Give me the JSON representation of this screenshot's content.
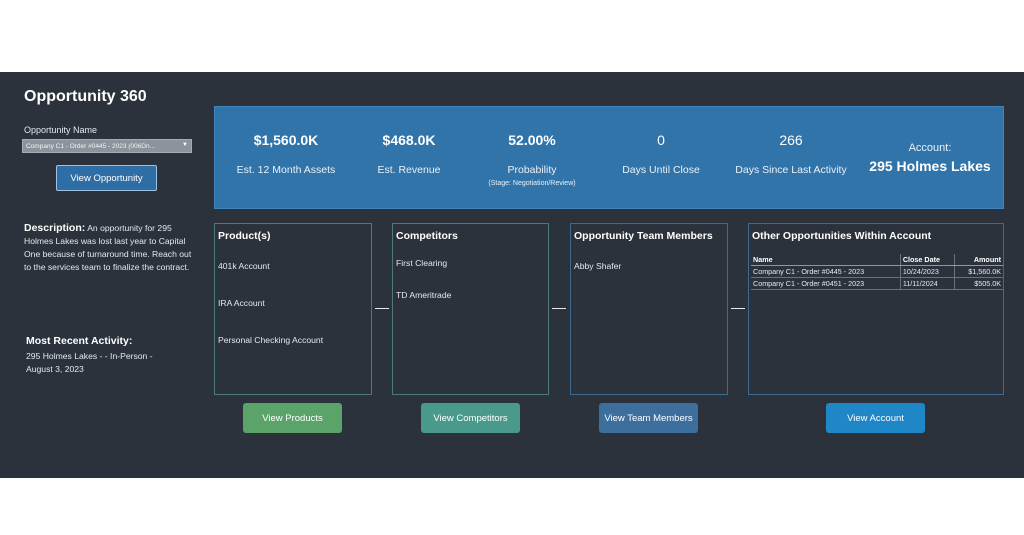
{
  "title": "Opportunity 360",
  "opportunity_filter": {
    "label": "Opportunity Name",
    "value": "Company C1 - Order #0445 - 2023 (006Dn..."
  },
  "view_opportunity_label": "View Opportunity",
  "description": {
    "label": "Description:",
    "text": "An opportunity for 295 Holmes Lakes was lost last year to Capital One because of turnaround time. Reach out to the services team to finalize the contract."
  },
  "recent_activity": {
    "title": "Most Recent Activity:",
    "text": "295 Holmes Lakes - - In-Person - August 3, 2023"
  },
  "kpis": [
    {
      "value": "$1,560.0K",
      "label": "Est. 12 Month Assets",
      "sub": ""
    },
    {
      "value": "$468.0K",
      "label": "Est. Revenue",
      "sub": ""
    },
    {
      "value": "52.00%",
      "label": "Probability",
      "sub": "(Stage: Negotiation/Review)"
    },
    {
      "value": "0",
      "label": "Days Until Close",
      "sub": ""
    },
    {
      "value": "266",
      "label": "Days Since Last Activity",
      "sub": ""
    }
  ],
  "account": {
    "label": "Account:",
    "name": "295 Holmes Lakes"
  },
  "products": {
    "title": "Product(s)",
    "items": [
      "401k Account",
      "IRA Account",
      "Personal Checking Account"
    ],
    "button": "View Products"
  },
  "competitors": {
    "title": "Competitors",
    "items": [
      "First Clearing",
      "TD Ameritrade"
    ],
    "button": "View Competitors"
  },
  "team": {
    "title": "Opportunity Team Members",
    "items": [
      "Abby Shafer"
    ],
    "button": "View Team Members"
  },
  "other_opps": {
    "title": "Other Opportunities Within Account",
    "columns": [
      "Name",
      "Close Date",
      "Amount"
    ],
    "rows": [
      [
        "Company C1 - Order #0445 - 2023",
        "10/24/2023",
        "$1,560.0K"
      ],
      [
        "Company C1 - Order #0451 - 2023",
        "11/11/2024",
        "$505.0K"
      ]
    ],
    "button": "View Account"
  },
  "colors": {
    "background": "#2b323b",
    "kpi_band": "#3174aa",
    "products_button": "#5aa46a",
    "competitors_button": "#4a9a8c",
    "team_button": "#3d6f9e",
    "account_button": "#1f86c8"
  }
}
